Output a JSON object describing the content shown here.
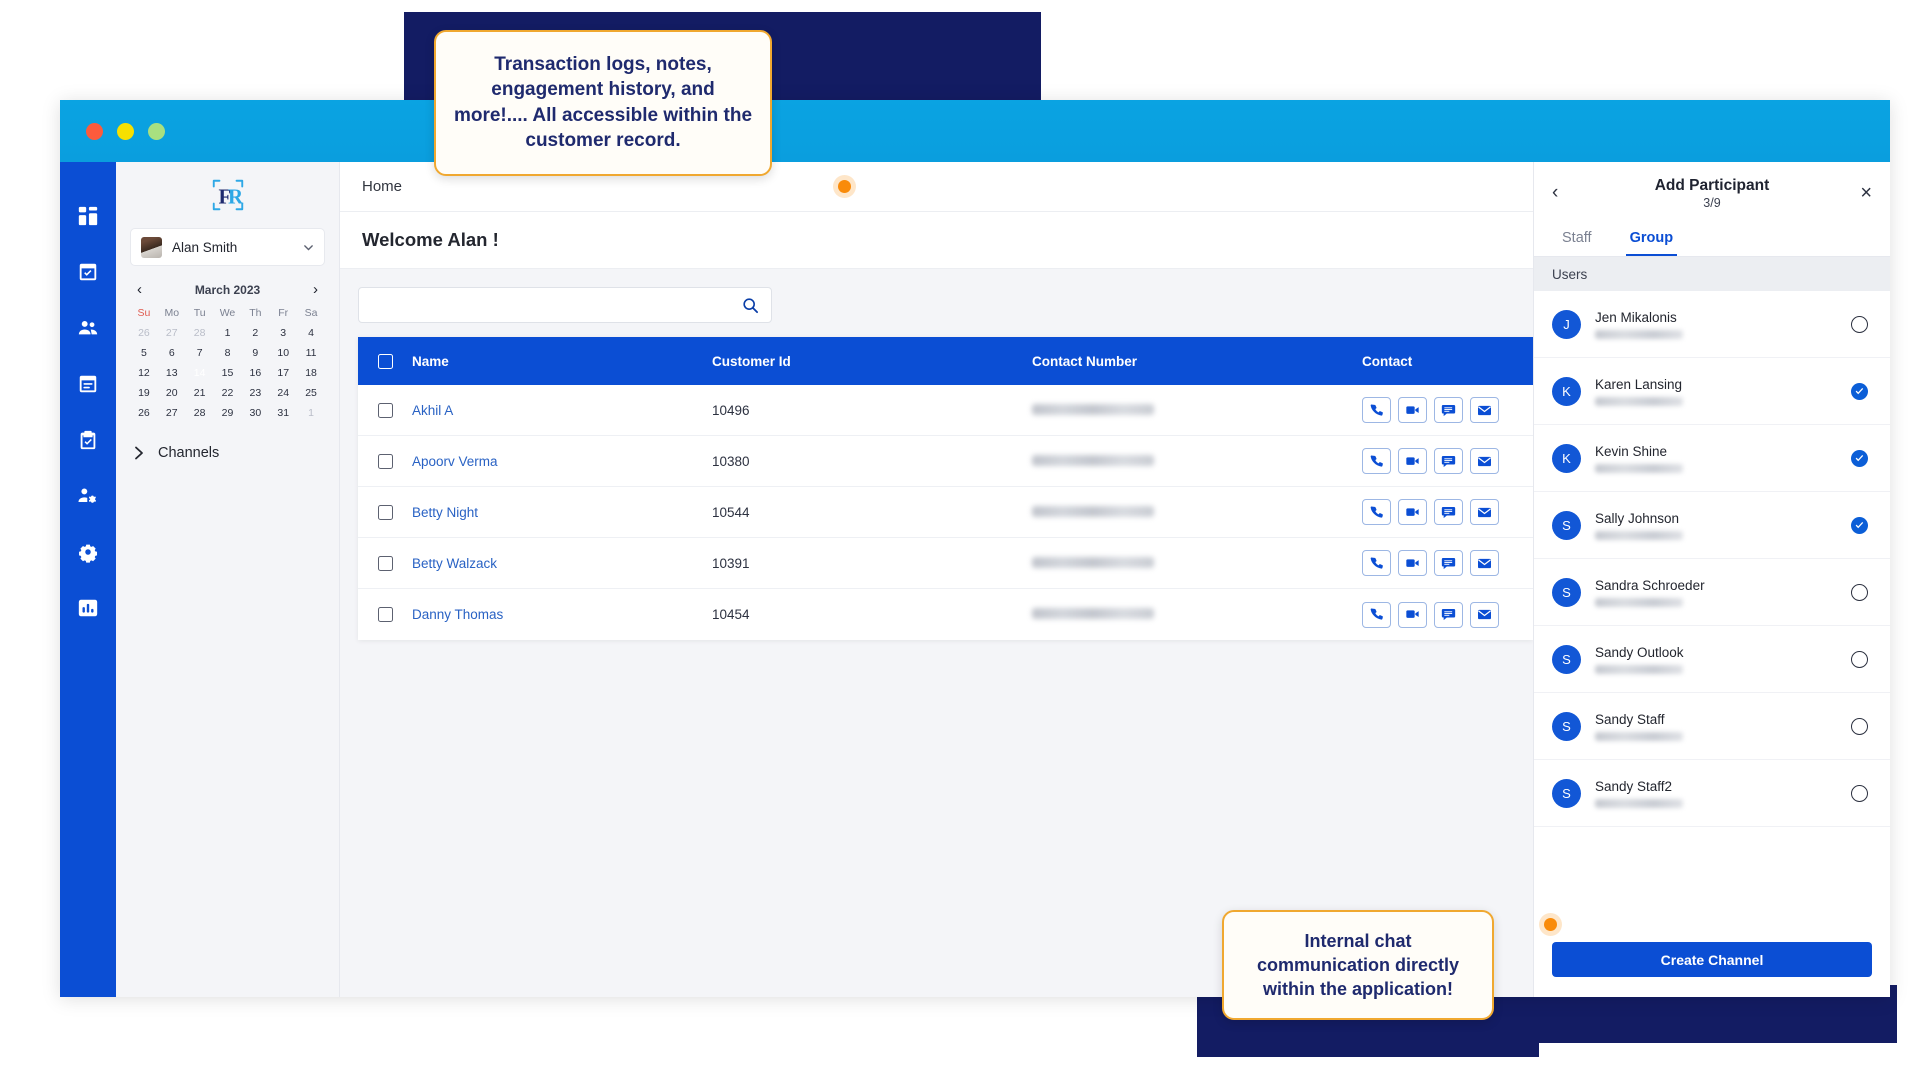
{
  "callouts": {
    "top": "Transaction logs, notes, engagement history, and more!.... All accessible within the customer record.",
    "bottom": "Internal chat communication directly within the application!"
  },
  "window": {
    "dots": [
      "close",
      "minimize",
      "maximize"
    ]
  },
  "rail": {
    "items": [
      {
        "name": "dashboard",
        "icon": "grid-icon"
      },
      {
        "name": "appointments",
        "icon": "calendar-check-icon"
      },
      {
        "name": "customers",
        "icon": "people-icon"
      },
      {
        "name": "schedule",
        "icon": "calendar-list-icon"
      },
      {
        "name": "tasks",
        "icon": "clipboard-check-icon"
      },
      {
        "name": "user-settings",
        "icon": "user-gear-icon"
      },
      {
        "name": "settings",
        "icon": "gear-icon"
      },
      {
        "name": "reports",
        "icon": "bar-chart-icon"
      }
    ]
  },
  "left_panel": {
    "logo_alt": "FR",
    "user": {
      "name": "Alan Smith"
    },
    "calendar": {
      "month_label": "March 2023",
      "prev_label": "‹",
      "next_label": "›",
      "dow": [
        "Su",
        "Mo",
        "Tu",
        "We",
        "Th",
        "Fr",
        "Sa"
      ],
      "weeks": [
        [
          {
            "d": "26",
            "mut": true
          },
          {
            "d": "27",
            "mut": true
          },
          {
            "d": "28",
            "mut": true
          },
          {
            "d": "1"
          },
          {
            "d": "2"
          },
          {
            "d": "3"
          },
          {
            "d": "4"
          }
        ],
        [
          {
            "d": "5"
          },
          {
            "d": "6"
          },
          {
            "d": "7"
          },
          {
            "d": "8"
          },
          {
            "d": "9"
          },
          {
            "d": "10"
          },
          {
            "d": "11"
          }
        ],
        [
          {
            "d": "12"
          },
          {
            "d": "13"
          },
          {
            "d": "14",
            "sel": true
          },
          {
            "d": "15"
          },
          {
            "d": "16"
          },
          {
            "d": "17"
          },
          {
            "d": "18"
          }
        ],
        [
          {
            "d": "19"
          },
          {
            "d": "20"
          },
          {
            "d": "21"
          },
          {
            "d": "22"
          },
          {
            "d": "23"
          },
          {
            "d": "24"
          },
          {
            "d": "25"
          }
        ],
        [
          {
            "d": "26"
          },
          {
            "d": "27"
          },
          {
            "d": "28"
          },
          {
            "d": "29"
          },
          {
            "d": "30"
          },
          {
            "d": "31"
          },
          {
            "d": "1",
            "mut": true
          }
        ]
      ],
      "selected_day": "14"
    },
    "channels_label": "Channels"
  },
  "main": {
    "breadcrumb": "Home",
    "welcome": "Welcome Alan !",
    "search": {
      "value": "",
      "placeholder": ""
    },
    "table": {
      "columns": [
        "Name",
        "Customer Id",
        "Contact Number",
        "Contact"
      ],
      "rows": [
        {
          "name": "Akhil A",
          "customer_id": "10496",
          "contact_number": "redacted"
        },
        {
          "name": "Apoorv Verma",
          "customer_id": "10380",
          "contact_number": "redacted"
        },
        {
          "name": "Betty Night",
          "customer_id": "10544",
          "contact_number": "redacted"
        },
        {
          "name": "Betty Walzack",
          "customer_id": "10391",
          "contact_number": "redacted"
        },
        {
          "name": "Danny Thomas",
          "customer_id": "10454",
          "contact_number": "redacted"
        }
      ],
      "action_icons": [
        "phone-icon",
        "video-icon",
        "chat-icon",
        "email-icon"
      ]
    }
  },
  "right_panel": {
    "title": "Add Participant",
    "counter": "3/9",
    "back_label": "‹",
    "close_label": "×",
    "tabs": [
      {
        "label": "Staff",
        "active": false
      },
      {
        "label": "Group",
        "active": true
      }
    ],
    "section_label": "Users",
    "users": [
      {
        "initial": "J",
        "name": "Jen Mikalonis",
        "selected": false
      },
      {
        "initial": "K",
        "name": "Karen Lansing",
        "selected": true
      },
      {
        "initial": "K",
        "name": "Kevin Shine",
        "selected": true
      },
      {
        "initial": "S",
        "name": "Sally Johnson",
        "selected": true
      },
      {
        "initial": "S",
        "name": "Sandra Schroeder",
        "selected": false
      },
      {
        "initial": "S",
        "name": "Sandy Outlook",
        "selected": false
      },
      {
        "initial": "S",
        "name": "Sandy Staff",
        "selected": false
      },
      {
        "initial": "S",
        "name": "Sandy Staff2",
        "selected": false
      }
    ],
    "create_button": "Create Channel"
  },
  "colors": {
    "brand_blue": "#0b4ed4",
    "title_cyan": "#0a9ede",
    "navy": "#131c63",
    "accent_orange": "#f0a830",
    "pulse_orange": "#f98b0a",
    "link_blue": "#2962c4"
  }
}
